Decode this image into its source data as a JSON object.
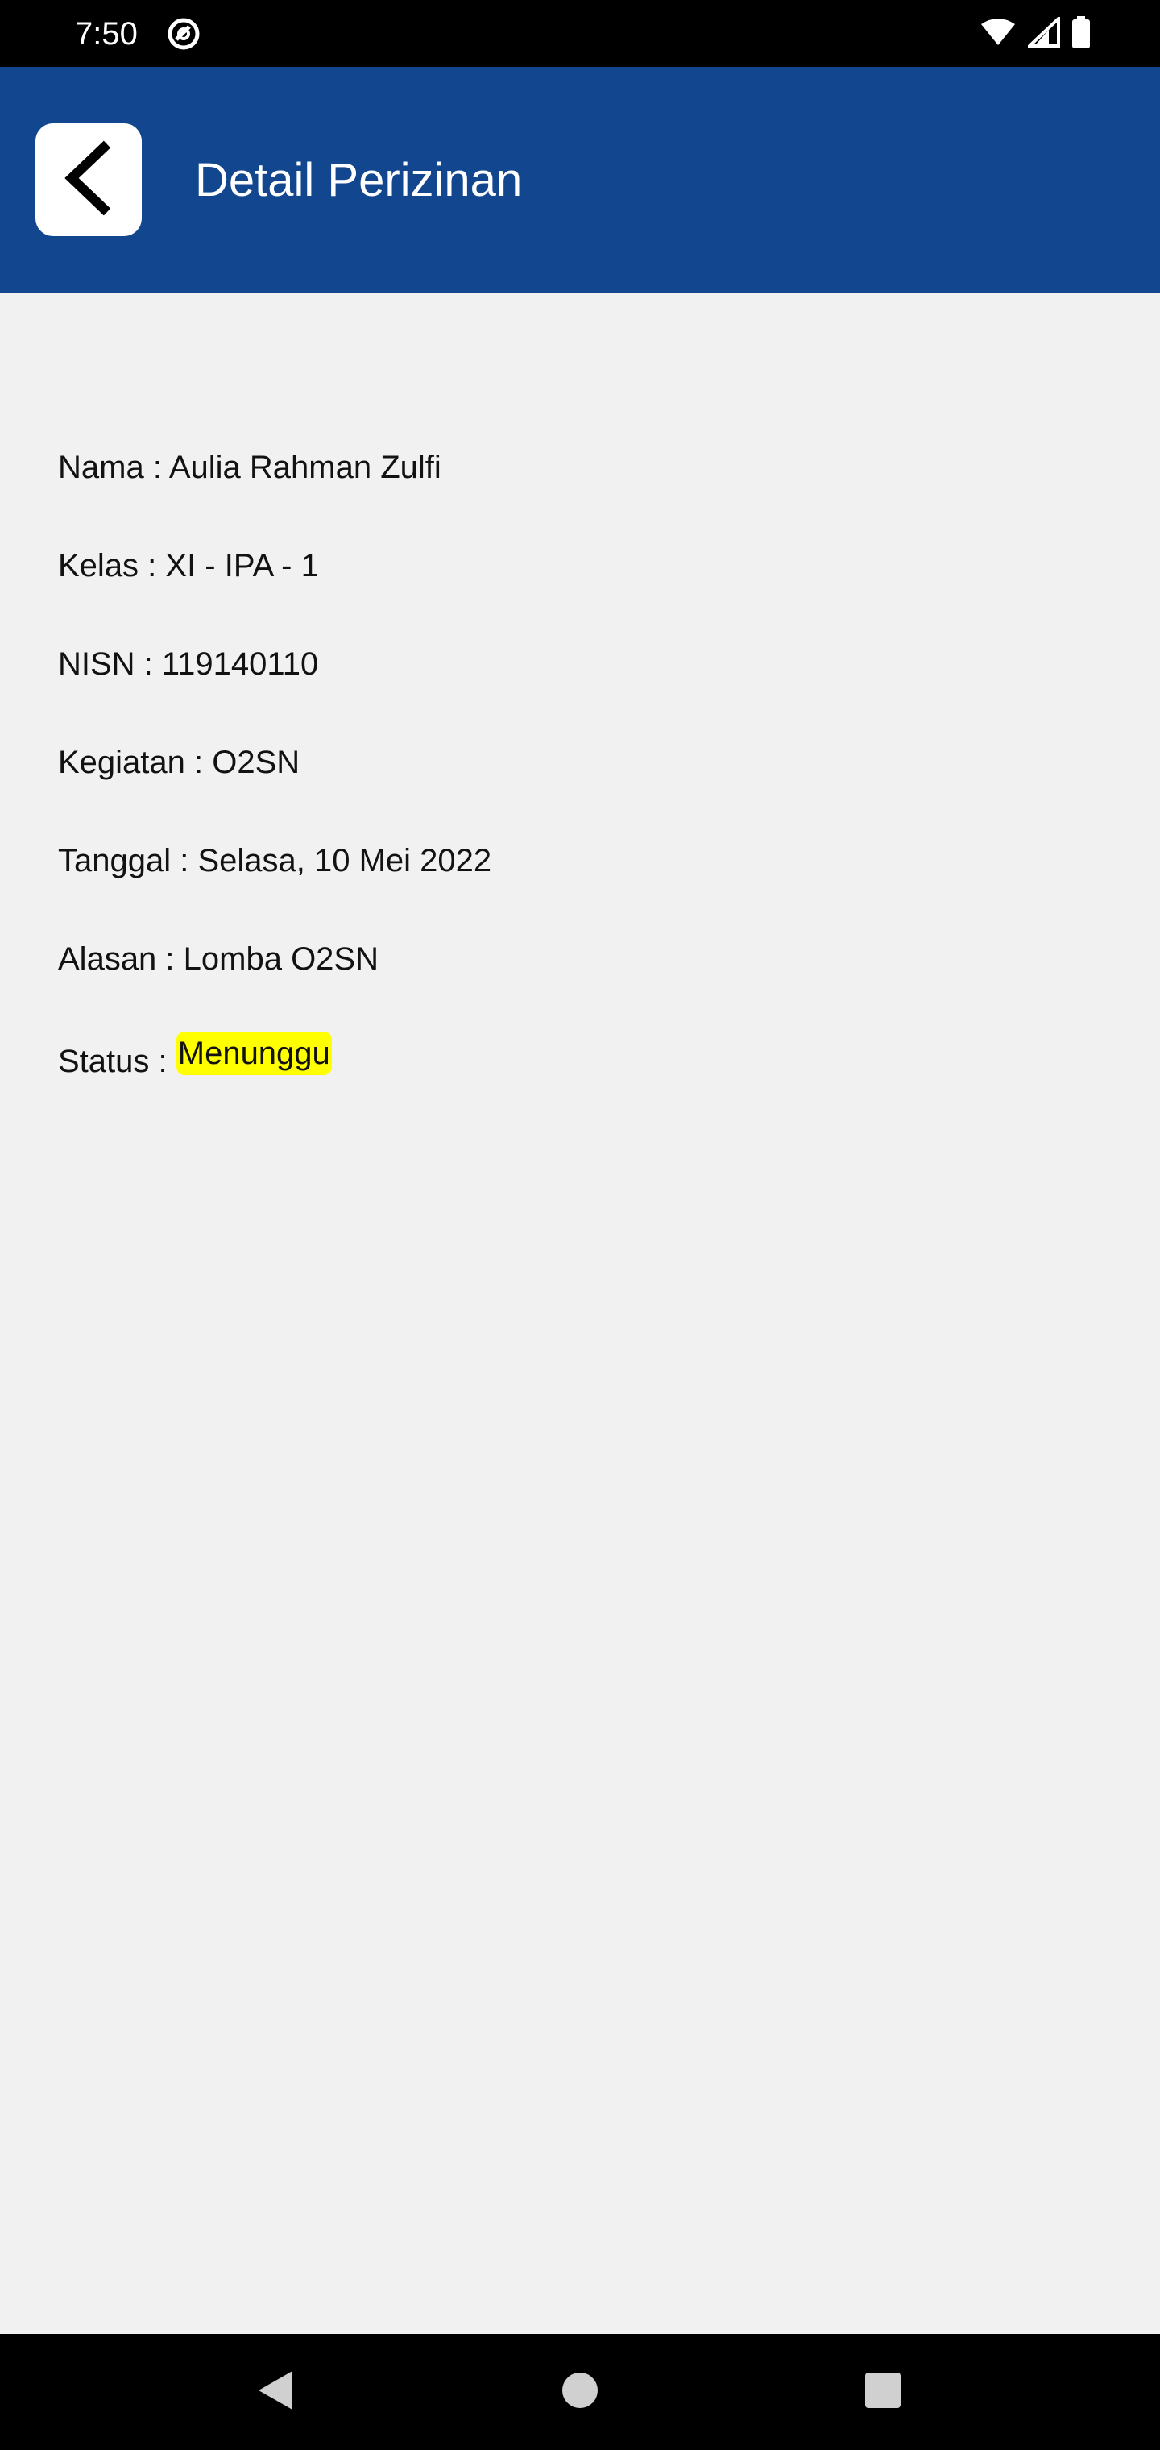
{
  "status_bar": {
    "time": "7:50",
    "icons": [
      "do-not-disturb-icon",
      "wifi-icon",
      "cellular-signal-icon",
      "battery-icon"
    ]
  },
  "header": {
    "title": "Detail Perizinan",
    "back_icon": "chevron-left-icon",
    "background_color": "#12478f"
  },
  "details": {
    "nama": "Nama : Aulia Rahman Zulfi",
    "kelas": "Kelas : XI - IPA - 1",
    "nisn": "NISN : 119140110",
    "kegiatan": "Kegiatan : O2SN",
    "tanggal": "Tanggal : Selasa, 10 Mei 2022",
    "alasan": "Alasan : Lomba O2SN",
    "status_label": "Status : ",
    "status_value": "Menunggu",
    "status_color": "#ffff00"
  },
  "nav_bar": {
    "buttons": [
      "back-nav-icon",
      "home-nav-icon",
      "recents-nav-icon"
    ]
  }
}
